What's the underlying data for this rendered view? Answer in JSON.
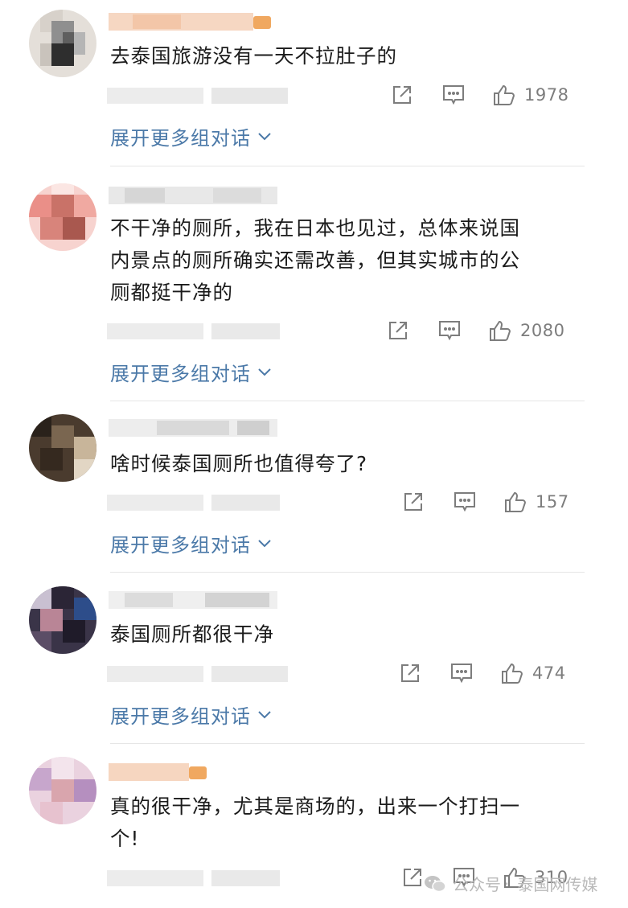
{
  "comments": [
    {
      "text_lines": [
        "去泰国旅游没有一天不拉肚子的"
      ],
      "likes": "1978",
      "expand_label": "展开更多组对话",
      "avatar_colors": [
        "#8a8a8a",
        "#cfcfcf",
        "#2e2e2e",
        "#e8e4df"
      ]
    },
    {
      "text_lines": [
        "不干净的厕所，我在日本也见过，总体来说国",
        "内景点的厕所确实还需改善，但其实城市的公",
        "厕都挺干净的"
      ],
      "likes": "2080",
      "expand_label": "展开更多组对话",
      "avatar_colors": [
        "#f5b8b2",
        "#d97b74",
        "#b1675f",
        "#fbe6e3"
      ]
    },
    {
      "text_lines": [
        "啥时候泰国厕所也值得夸了?"
      ],
      "likes": "157",
      "expand_label": "展开更多组对话",
      "avatar_colors": [
        "#3d2f24",
        "#6d5a45",
        "#b8a58c",
        "#1e1a16"
      ]
    },
    {
      "text_lines": [
        "泰国厕所都很干净"
      ],
      "likes": "474",
      "expand_label": "展开更多组对话",
      "avatar_colors": [
        "#2a2a3a",
        "#5a4b6a",
        "#c07a8a",
        "#1c2a4a"
      ]
    },
    {
      "text_lines": [
        "真的很干净，尤其是商场的，出来一个打扫一",
        "个!"
      ],
      "likes": "310",
      "expand_label": "",
      "avatar_colors": [
        "#e8c6d8",
        "#c9a3c9",
        "#d8a0a8",
        "#f1e1ea"
      ]
    }
  ],
  "watermark": {
    "platform": "公众号",
    "separator": "·",
    "account": "泰国网传媒"
  },
  "icons": {
    "share": "share-icon",
    "comment": "comment-icon",
    "like": "thumbs-up-icon",
    "expand": "chevron-down-icon",
    "wechat": "wechat-icon"
  },
  "colors": {
    "link": "#4b79a8",
    "meta": "#7d7d7d",
    "text": "#1b1b1b"
  }
}
